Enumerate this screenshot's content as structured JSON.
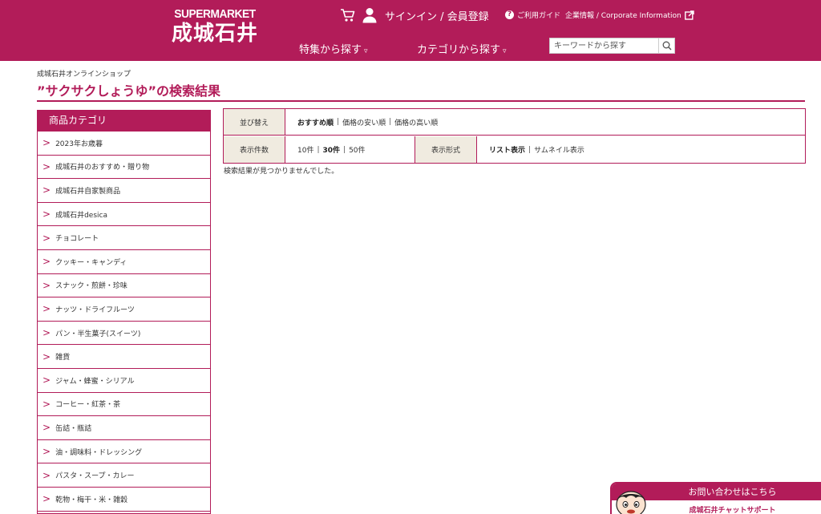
{
  "header": {
    "logo_top": "SUPERMARKET",
    "logo_main": "成城石井",
    "signin": "サインイン / 会員登録",
    "guide": "ご利用ガイド",
    "corporate": "企業情報 / Corporate Information",
    "nav_feature": "特集から探す",
    "nav_category": "カテゴリから探す",
    "nav_caret": "▿",
    "search_placeholder": "キーワードから探す",
    "icons": [
      "cart-icon",
      "user-icon",
      "help-icon",
      "external-link-icon",
      "search-icon"
    ]
  },
  "breadcrumb": "成城石井オンラインショップ",
  "page_title": "”サクサクしょうゆ”の検索結果",
  "sidebar": {
    "title": "商品カテゴリ",
    "items": [
      "2023年お歳暮",
      "成城石井のおすすめ・贈り物",
      "成城石井自家製商品",
      "成城石井desica",
      "チョコレート",
      "クッキー・キャンディ",
      "スナック・煎餅・珍味",
      "ナッツ・ドライフルーツ",
      "パン・半生菓子(スイーツ)",
      "雑貨",
      "ジャム・蜂蜜・シリアル",
      "コーヒー・紅茶・茶",
      "缶詰・瓶詰",
      "油・調味料・ドレッシング",
      "パスタ・スープ・カレー",
      "乾物・梅干・米・雑穀"
    ]
  },
  "sort": {
    "label": "並び替え",
    "options": [
      "おすすめ順",
      "価格の安い順",
      "価格の高い順"
    ],
    "active": "おすすめ順"
  },
  "count": {
    "label": "表示件数",
    "options": [
      "10件",
      "30件",
      "50件"
    ],
    "active": "30件"
  },
  "view": {
    "label": "表示形式",
    "options": [
      "リスト表示",
      "サムネイル表示"
    ],
    "active": "リスト表示"
  },
  "no_results": "検索結果が見つかりませんでした。",
  "chat": {
    "title": "お問い合わせはこちら",
    "subtitle": "成城石井チャットサポート"
  },
  "colors": {
    "brand": "#b21c59",
    "label_bg": "#f0ebe0"
  }
}
